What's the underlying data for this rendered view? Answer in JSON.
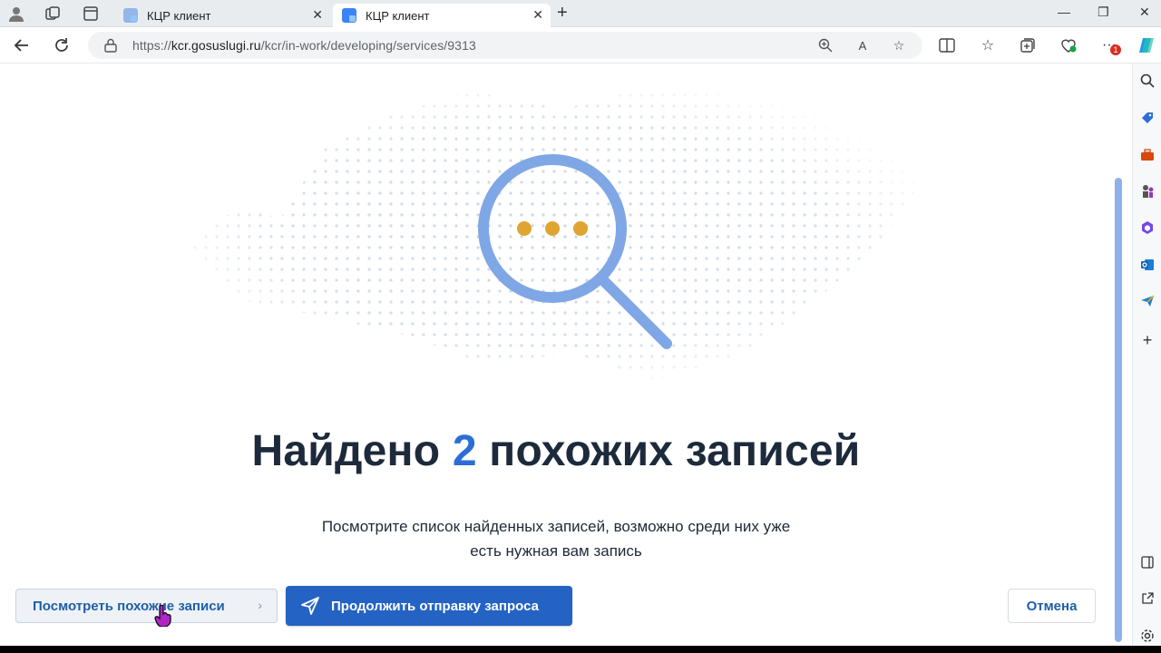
{
  "browser": {
    "tabs": [
      {
        "label": "КЦР клиент",
        "active": false
      },
      {
        "label": "КЦР клиент",
        "active": true
      }
    ],
    "address": {
      "url_prefix": "https://",
      "url_host": "kcr.gosuslugi.ru",
      "url_path": "/kcr/in-work/developing/services/9313"
    },
    "notification_badge": "1"
  },
  "main": {
    "heading_before": "Найдено ",
    "heading_count": "2",
    "heading_after": " похожих записей",
    "subtext_line1": "Посмотрите список найденных записей, возможно среди них уже",
    "subtext_line2": "есть нужная вам запись"
  },
  "actions": {
    "view_similar_label": "Посмотреть похожие записи",
    "continue_label": "Продолжить отправку запроса",
    "cancel_label": "Отмена"
  },
  "colors": {
    "accent": "#2463c3",
    "heading_number": "#2c6ed5",
    "magnifier": "#7fa7e6",
    "dots": "#e0a431"
  }
}
